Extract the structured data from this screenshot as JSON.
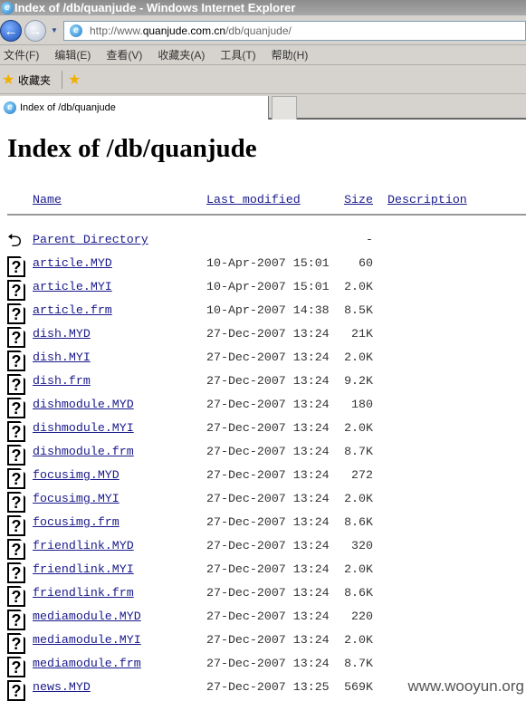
{
  "window": {
    "title": "Index of /db/quanjude - Windows Internet Explorer"
  },
  "address": {
    "prefix": "http://www.",
    "domain": "quanjude.com.cn",
    "path": "/db/quanjude/"
  },
  "menu": [
    "文件(F)",
    "编辑(E)",
    "查看(V)",
    "收藏夹(A)",
    "工具(T)",
    "帮助(H)"
  ],
  "favorites": {
    "label": "收藏夹"
  },
  "tab": {
    "label": "Index of /db/quanjude"
  },
  "page": {
    "heading": "Index of /db/quanjude",
    "columns": {
      "name": "Name",
      "modified": "Last modified",
      "size": "Size",
      "description": "Description"
    },
    "parent": {
      "name": "Parent Directory",
      "size": "-"
    },
    "files": [
      {
        "name": "article.MYD",
        "modified": "10-Apr-2007 15:01",
        "size": "60"
      },
      {
        "name": "article.MYI",
        "modified": "10-Apr-2007 15:01",
        "size": "2.0K"
      },
      {
        "name": "article.frm",
        "modified": "10-Apr-2007 14:38",
        "size": "8.5K"
      },
      {
        "name": "dish.MYD",
        "modified": "27-Dec-2007 13:24",
        "size": "21K"
      },
      {
        "name": "dish.MYI",
        "modified": "27-Dec-2007 13:24",
        "size": "2.0K"
      },
      {
        "name": "dish.frm",
        "modified": "27-Dec-2007 13:24",
        "size": "9.2K"
      },
      {
        "name": "dishmodule.MYD",
        "modified": "27-Dec-2007 13:24",
        "size": "180"
      },
      {
        "name": "dishmodule.MYI",
        "modified": "27-Dec-2007 13:24",
        "size": "2.0K"
      },
      {
        "name": "dishmodule.frm",
        "modified": "27-Dec-2007 13:24",
        "size": "8.7K"
      },
      {
        "name": "focusimg.MYD",
        "modified": "27-Dec-2007 13:24",
        "size": "272"
      },
      {
        "name": "focusimg.MYI",
        "modified": "27-Dec-2007 13:24",
        "size": "2.0K"
      },
      {
        "name": "focusimg.frm",
        "modified": "27-Dec-2007 13:24",
        "size": "8.6K"
      },
      {
        "name": "friendlink.MYD",
        "modified": "27-Dec-2007 13:24",
        "size": "320"
      },
      {
        "name": "friendlink.MYI",
        "modified": "27-Dec-2007 13:24",
        "size": "2.0K"
      },
      {
        "name": "friendlink.frm",
        "modified": "27-Dec-2007 13:24",
        "size": "8.6K"
      },
      {
        "name": "mediamodule.MYD",
        "modified": "27-Dec-2007 13:24",
        "size": "220"
      },
      {
        "name": "mediamodule.MYI",
        "modified": "27-Dec-2007 13:24",
        "size": "2.0K"
      },
      {
        "name": "mediamodule.frm",
        "modified": "27-Dec-2007 13:24",
        "size": "8.7K"
      },
      {
        "name": "news.MYD",
        "modified": "27-Dec-2007 13:25",
        "size": "569K"
      }
    ]
  },
  "watermark": "www.wooyun.org"
}
